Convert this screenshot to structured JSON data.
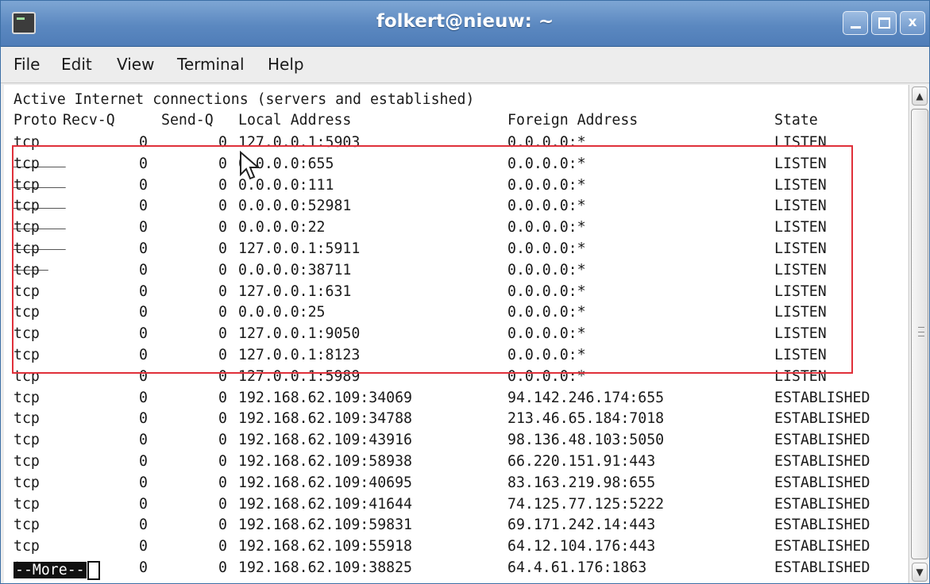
{
  "window": {
    "title": "folkert@nieuw: ~",
    "icon": "terminal-icon",
    "controls": {
      "minimize": "minimize-icon",
      "maximize": "maximize-icon",
      "close": "close-icon",
      "close_glyph": "x"
    }
  },
  "menu": [
    "File",
    "Edit",
    "View",
    "Terminal",
    "Help"
  ],
  "terminal": {
    "heading": "Active Internet connections (servers and established)",
    "columns": {
      "proto": "Proto",
      "recvq": "Recv-Q",
      "sendq": "Send-Q",
      "local": "Local Address",
      "foreign": "Foreign Address",
      "state": "State"
    },
    "rows": [
      {
        "proto": "tcp",
        "recvq": "0",
        "sendq": "0",
        "local": "127.0.0.1:5903",
        "foreign": "0.0.0.0:*",
        "state": "LISTEN"
      },
      {
        "proto": "tcp",
        "recvq": "0",
        "sendq": "0",
        "local": "0.0.0.0:655",
        "foreign": "0.0.0.0:*",
        "state": "LISTEN"
      },
      {
        "proto": "tcp",
        "recvq": "0",
        "sendq": "0",
        "local": "0.0.0.0:111",
        "foreign": "0.0.0.0:*",
        "state": "LISTEN"
      },
      {
        "proto": "tcp",
        "recvq": "0",
        "sendq": "0",
        "local": "0.0.0.0:52981",
        "foreign": "0.0.0.0:*",
        "state": "LISTEN"
      },
      {
        "proto": "tcp",
        "recvq": "0",
        "sendq": "0",
        "local": "0.0.0.0:22",
        "foreign": "0.0.0.0:*",
        "state": "LISTEN"
      },
      {
        "proto": "tcp",
        "recvq": "0",
        "sendq": "0",
        "local": "127.0.0.1:5911",
        "foreign": "0.0.0.0:*",
        "state": "LISTEN"
      },
      {
        "proto": "tcp",
        "recvq": "0",
        "sendq": "0",
        "local": "0.0.0.0:38711",
        "foreign": "0.0.0.0:*",
        "state": "LISTEN"
      },
      {
        "proto": "tcp",
        "recvq": "0",
        "sendq": "0",
        "local": "127.0.0.1:631",
        "foreign": "0.0.0.0:*",
        "state": "LISTEN"
      },
      {
        "proto": "tcp",
        "recvq": "0",
        "sendq": "0",
        "local": "0.0.0.0:25",
        "foreign": "0.0.0.0:*",
        "state": "LISTEN"
      },
      {
        "proto": "tcp",
        "recvq": "0",
        "sendq": "0",
        "local": "127.0.0.1:9050",
        "foreign": "0.0.0.0:*",
        "state": "LISTEN"
      },
      {
        "proto": "tcp",
        "recvq": "0",
        "sendq": "0",
        "local": "127.0.0.1:8123",
        "foreign": "0.0.0.0:*",
        "state": "LISTEN"
      },
      {
        "proto": "tcp",
        "recvq": "0",
        "sendq": "0",
        "local": "127.0.0.1:5989",
        "foreign": "0.0.0.0:*",
        "state": "LISTEN"
      },
      {
        "proto": "tcp",
        "recvq": "0",
        "sendq": "0",
        "local": "192.168.62.109:34069",
        "foreign": "94.142.246.174:655",
        "state": "ESTABLISHED"
      },
      {
        "proto": "tcp",
        "recvq": "0",
        "sendq": "0",
        "local": "192.168.62.109:34788",
        "foreign": "213.46.65.184:7018",
        "state": "ESTABLISHED"
      },
      {
        "proto": "tcp",
        "recvq": "0",
        "sendq": "0",
        "local": "192.168.62.109:43916",
        "foreign": "98.136.48.103:5050",
        "state": "ESTABLISHED"
      },
      {
        "proto": "tcp",
        "recvq": "0",
        "sendq": "0",
        "local": "192.168.62.109:58938",
        "foreign": "66.220.151.91:443",
        "state": "ESTABLISHED"
      },
      {
        "proto": "tcp",
        "recvq": "0",
        "sendq": "0",
        "local": "192.168.62.109:40695",
        "foreign": "83.163.219.98:655",
        "state": "ESTABLISHED"
      },
      {
        "proto": "tcp",
        "recvq": "0",
        "sendq": "0",
        "local": "192.168.62.109:41644",
        "foreign": "74.125.77.125:5222",
        "state": "ESTABLISHED"
      },
      {
        "proto": "tcp",
        "recvq": "0",
        "sendq": "0",
        "local": "192.168.62.109:59831",
        "foreign": "69.171.242.14:443",
        "state": "ESTABLISHED"
      },
      {
        "proto": "tcp",
        "recvq": "0",
        "sendq": "0",
        "local": "192.168.62.109:55918",
        "foreign": "64.12.104.176:443",
        "state": "ESTABLISHED"
      },
      {
        "proto": "tcp",
        "recvq": "0",
        "sendq": "0",
        "local": "192.168.62.109:38825",
        "foreign": "64.4.61.176:1863",
        "state": "ESTABLISHED"
      }
    ],
    "pager_prompt": "--More--"
  },
  "colors": {
    "titlebar": "#5b88c0",
    "highlight_box": "#e0303a",
    "terminal_bg": "#ffffff",
    "terminal_fg": "#1a1a1a"
  },
  "scrollbar": {
    "up": "scroll-up-icon",
    "down": "scroll-down-icon"
  }
}
